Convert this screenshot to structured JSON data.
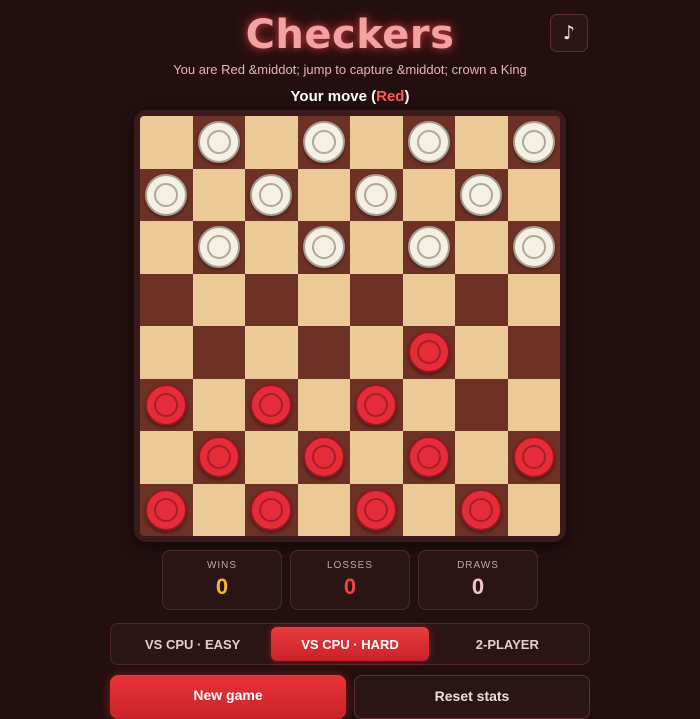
{
  "header": {
    "title": "Checkers",
    "subtitle": "You are Red &middot; jump to capture &middot; crown a King",
    "music_icon": "♪"
  },
  "status": {
    "prefix": "Your move (",
    "player": "Red",
    "suffix": ")"
  },
  "board": {
    "rows": [
      ". w . w . w . w",
      "w . w . w . w .",
      ". w . w . w . w",
      ". . . . . . . .",
      ". . . . . r . .",
      "r . r . r . . .",
      ". r . r . r . r",
      "r . r . r . r ."
    ],
    "colors": {
      "light_square": "#ecca98",
      "dark_square": "#6e3125",
      "red_piece": "#e62c38",
      "white_piece": "#f5f0e4"
    }
  },
  "stats": {
    "wins": {
      "label": "WINS",
      "value": "0",
      "color": "#f2b632"
    },
    "losses": {
      "label": "LOSSES",
      "value": "0",
      "color": "#ef4444"
    },
    "draws": {
      "label": "DRAWS",
      "value": "0",
      "color": "#f3c4c4"
    }
  },
  "modes": [
    {
      "label": "VS CPU · EASY",
      "active": false
    },
    {
      "label": "VS CPU · HARD",
      "active": true
    },
    {
      "label": "2-PLAYER",
      "active": false
    }
  ],
  "actions": {
    "new_game": "New game",
    "reset_stats": "Reset stats"
  }
}
